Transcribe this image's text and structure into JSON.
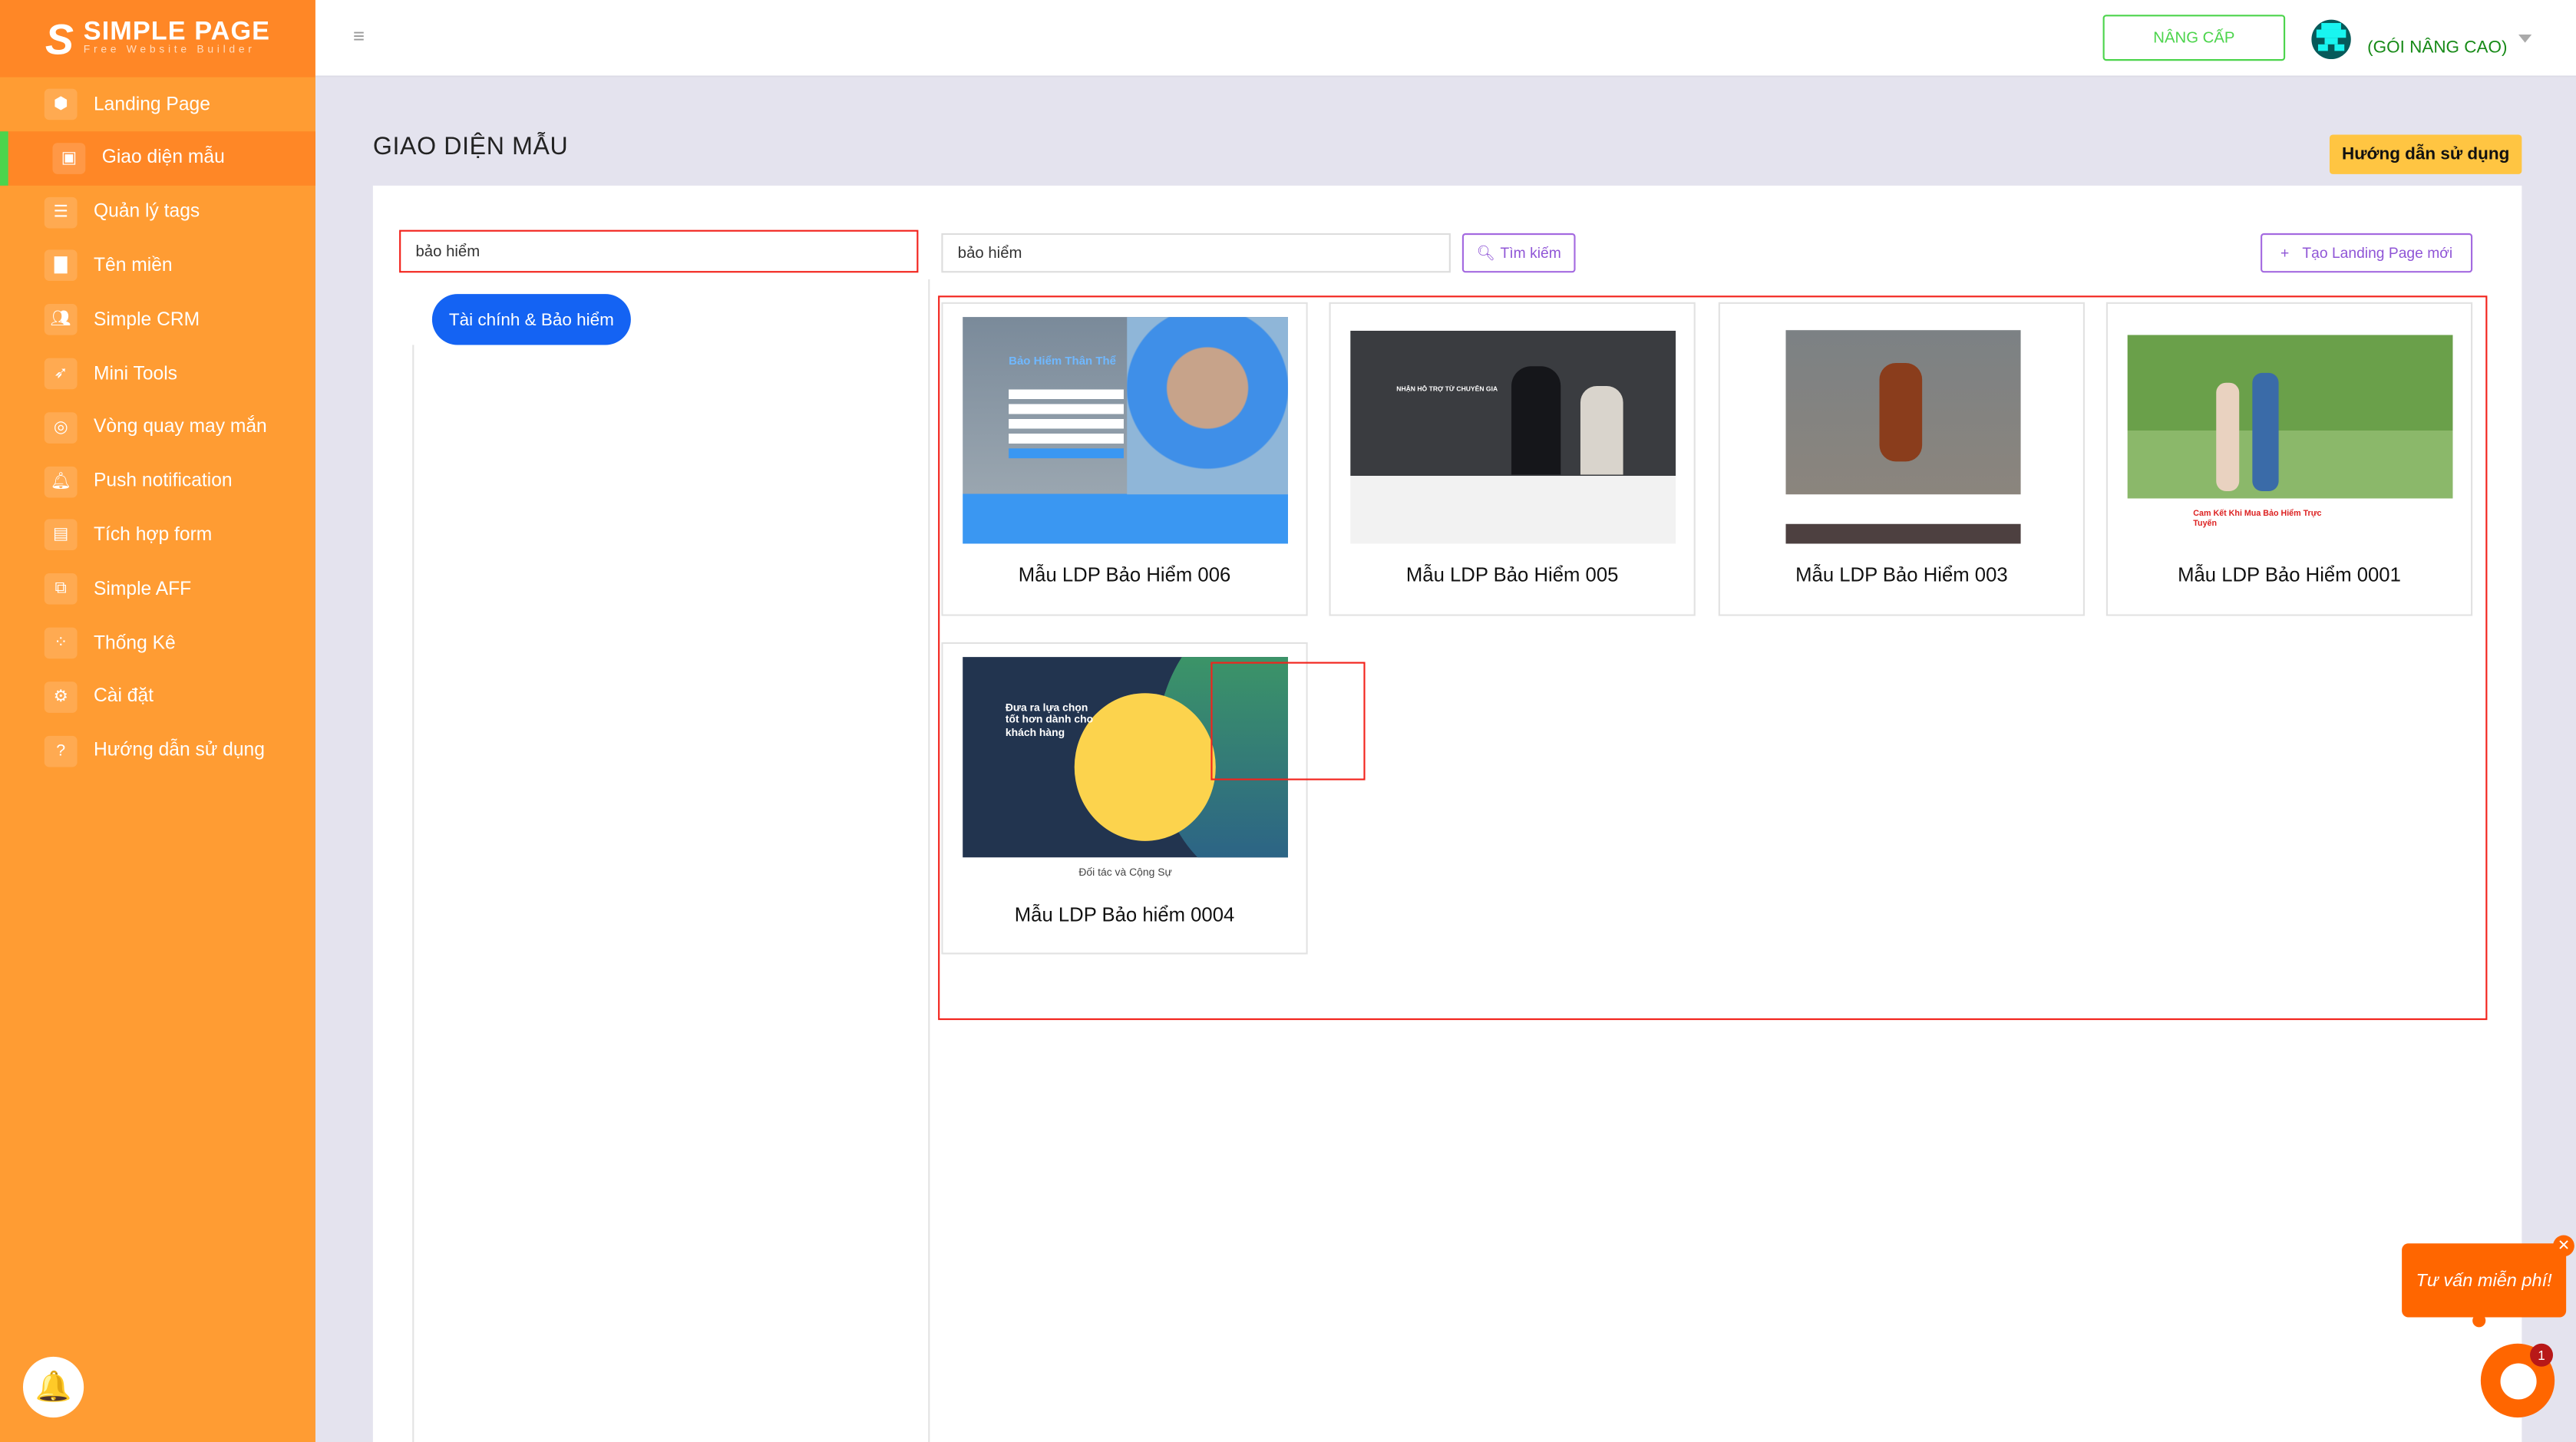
{
  "brand": {
    "name": "SIMPLE PAGE",
    "tagline": "Free Website Builder",
    "accent": "#FF9C33"
  },
  "sidebar": {
    "items": [
      {
        "label": "Landing Page",
        "icon": "cube-icon"
      },
      {
        "label": "Giao diện mẫu",
        "icon": "template-icon",
        "active": true
      },
      {
        "label": "Quản lý tags",
        "icon": "list-icon"
      },
      {
        "label": "Tên miền",
        "icon": "bar-chart-icon"
      },
      {
        "label": "Simple CRM",
        "icon": "users-icon"
      },
      {
        "label": "Mini Tools",
        "icon": "rocket-icon"
      },
      {
        "label": "Vòng quay may mắn",
        "icon": "wheel-icon"
      },
      {
        "label": "Push notification",
        "icon": "bell-icon"
      },
      {
        "label": "Tích hợp form",
        "icon": "form-icon"
      },
      {
        "label": "Simple AFF",
        "icon": "share-icon"
      },
      {
        "label": "Thống Kê",
        "icon": "stats-icon"
      },
      {
        "label": "Cài đặt",
        "icon": "gear-icon"
      },
      {
        "label": "Hướng dẫn sử dụng",
        "icon": "help-icon"
      }
    ]
  },
  "header": {
    "upgrade_label": "NÂNG CẤP",
    "plan_label": "(GÓI NÂNG CAO)"
  },
  "page": {
    "title": "GIAO DIỆN MẪU",
    "guide_label": "Hướng dẫn sử dụng"
  },
  "filters": {
    "category_input": "bảo hiểm",
    "category_tag": "Tài chính & Bảo hiểm",
    "search_value": "bảo hiểm",
    "search_button": "Tìm kiếm",
    "create_button": "Tạo Landing Page mới"
  },
  "templates": [
    {
      "name": "Mẫu LDP Bảo Hiểm 006",
      "thumb_text": "Bảo Hiểm Thân Thể"
    },
    {
      "name": "Mẫu LDP Bảo Hiểm 005",
      "thumb_text": "NHẬN HỖ TRỢ TỪ CHUYÊN GIA"
    },
    {
      "name": "Mẫu LDP Bảo Hiểm 003"
    },
    {
      "name": "Mẫu LDP Bảo Hiểm 0001",
      "thumb_text": "Cam Kết Khi Mua Bảo Hiểm Trực Tuyến"
    },
    {
      "name": "Mẫu LDP Bảo hiểm 0004",
      "thumb_text": "Đưa ra lựa chọn tốt hơn dành cho khách hàng",
      "caption": "Đối tác và Cộng Sự"
    }
  ],
  "chat": {
    "prompt": "Tư vấn miễn phí!",
    "badge": "1"
  }
}
